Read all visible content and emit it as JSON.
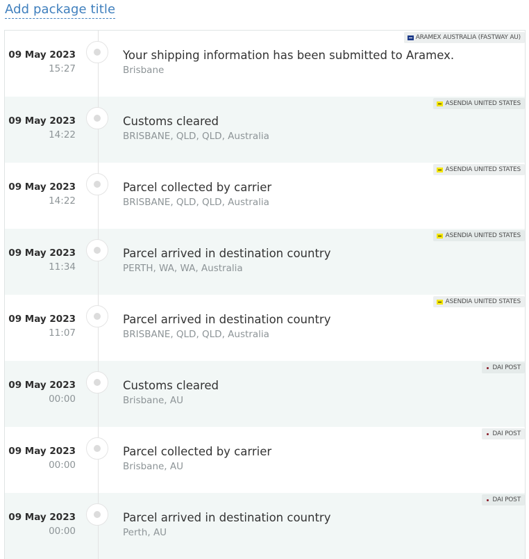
{
  "header": {
    "add_title_label": "Add package title"
  },
  "colors": {
    "link": "#3f7fbd",
    "row_shaded": "#f2f7f6",
    "aramex_flag": "#1e3b8a",
    "asendia_flag": "#f3e400",
    "dai_flag": "#8a1d2a"
  },
  "events": [
    {
      "date": "09 May 2023",
      "time": "15:27",
      "status": "Your shipping information has been submitted to Aramex.",
      "location": "Brisbane",
      "carrier": "ARAMEX AUSTRALIA (FASTWAY AU)",
      "carrier_icon": "aramex-flag-icon"
    },
    {
      "date": "09 May 2023",
      "time": "14:22",
      "status": "Customs cleared",
      "location": "BRISBANE, QLD, QLD, Australia",
      "carrier": "ASENDIA UNITED STATES",
      "carrier_icon": "asendia-flag-icon"
    },
    {
      "date": "09 May 2023",
      "time": "14:22",
      "status": "Parcel collected by carrier",
      "location": "BRISBANE, QLD, QLD, Australia",
      "carrier": "ASENDIA UNITED STATES",
      "carrier_icon": "asendia-flag-icon"
    },
    {
      "date": "09 May 2023",
      "time": "11:34",
      "status": "Parcel arrived in destination country",
      "location": "PERTH, WA, WA, Australia",
      "carrier": "ASENDIA UNITED STATES",
      "carrier_icon": "asendia-flag-icon"
    },
    {
      "date": "09 May 2023",
      "time": "11:07",
      "status": "Parcel arrived in destination country",
      "location": "BRISBANE, QLD, QLD, Australia",
      "carrier": "ASENDIA UNITED STATES",
      "carrier_icon": "asendia-flag-icon"
    },
    {
      "date": "09 May 2023",
      "time": "00:00",
      "status": "Customs cleared",
      "location": "Brisbane, AU",
      "carrier": "DAI POST",
      "carrier_icon": "dai-flag-icon"
    },
    {
      "date": "09 May 2023",
      "time": "00:00",
      "status": "Parcel collected by carrier",
      "location": "Brisbane, AU",
      "carrier": "DAI POST",
      "carrier_icon": "dai-flag-icon"
    },
    {
      "date": "09 May 2023",
      "time": "00:00",
      "status": "Parcel arrived in destination country",
      "location": "Perth, AU",
      "carrier": "DAI POST",
      "carrier_icon": "dai-flag-icon"
    }
  ]
}
